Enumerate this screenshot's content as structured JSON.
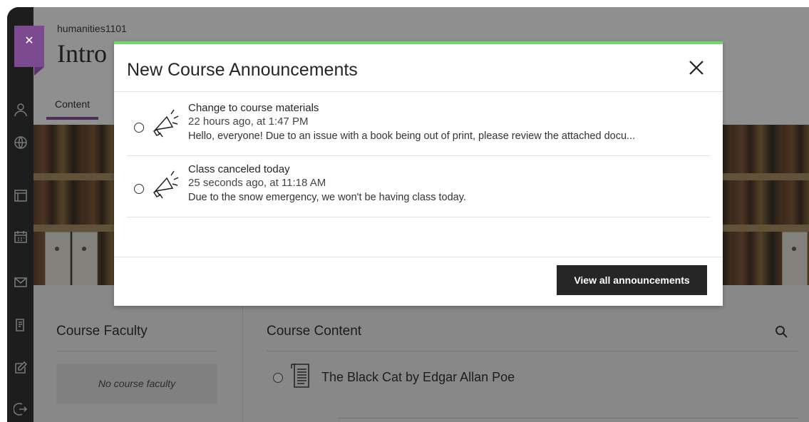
{
  "header": {
    "breadcrumb": "humanities1101",
    "course_title": "Intro",
    "tabs": [
      {
        "label": "Content"
      }
    ]
  },
  "lower": {
    "faculty_title": "Course Faculty",
    "no_faculty": "No course faculty",
    "content_title": "Course Content",
    "content_items": [
      {
        "title": "The Black Cat by Edgar Allan Poe"
      }
    ]
  },
  "modal": {
    "title": "New Course Announcements",
    "announcements": [
      {
        "title": "Change to course materials",
        "time": "22 hours ago, at 1:47 PM",
        "text": "Hello, everyone! Due to an issue with a book being out of print, please review the attached docu..."
      },
      {
        "title": "Class canceled today",
        "time": "25 seconds ago, at 11:18 AM",
        "text": "Due to the snow emergency, we won't be having class today."
      }
    ],
    "button_label": "View all announcements"
  },
  "colors": {
    "accent_purple": "#7b4a8f",
    "modal_top_border": "#6fda67",
    "nav_background": "#262626",
    "button_background": "#262626"
  },
  "icons": {
    "nav": [
      "close-icon",
      "person-icon",
      "globe-icon",
      "courses-icon",
      "calendar-icon",
      "mail-icon",
      "grades-icon",
      "edit-icon",
      "sign-out-icon"
    ],
    "announcement": "megaphone-icon",
    "content": "document-icon",
    "search": "search-icon",
    "modal_close": "close-icon"
  }
}
